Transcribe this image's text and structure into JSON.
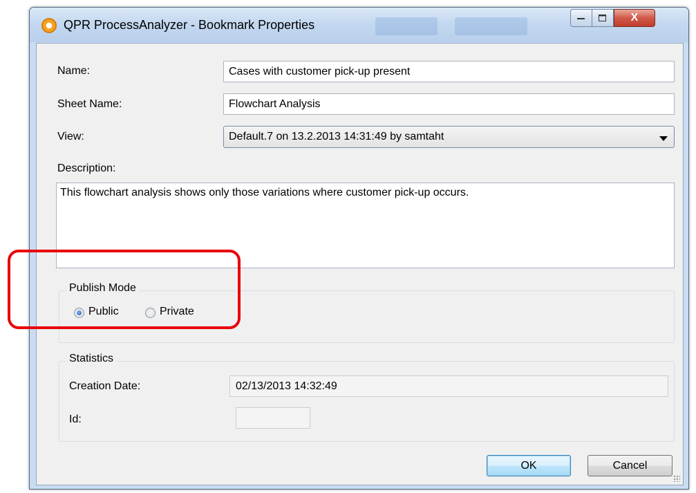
{
  "window": {
    "title": "QPR ProcessAnalyzer - Bookmark Properties",
    "close_glyph": "X"
  },
  "form": {
    "name_label": "Name:",
    "name_value": "Cases with customer pick-up present",
    "sheet_label": "Sheet Name:",
    "sheet_value": "Flowchart Analysis",
    "view_label": "View:",
    "view_value": "Default.7 on 13.2.2013 14:31:49 by samtaht",
    "description_label": "Description:",
    "description_value": "This flowchart analysis shows only those variations where customer pick-up occurs."
  },
  "publish_mode": {
    "title": "Publish Mode",
    "options": [
      {
        "label": "Public",
        "selected": true
      },
      {
        "label": "Private",
        "selected": false
      }
    ]
  },
  "statistics": {
    "title": "Statistics",
    "creation_date_label": "Creation Date:",
    "creation_date_value": "02/13/2013 14:32:49",
    "id_label": "Id:",
    "id_value": ""
  },
  "buttons": {
    "ok": "OK",
    "cancel": "Cancel"
  },
  "colors": {
    "highlight": "#e8000b",
    "title_bar": "#c4d8f0",
    "close_button": "#c03d2c"
  }
}
